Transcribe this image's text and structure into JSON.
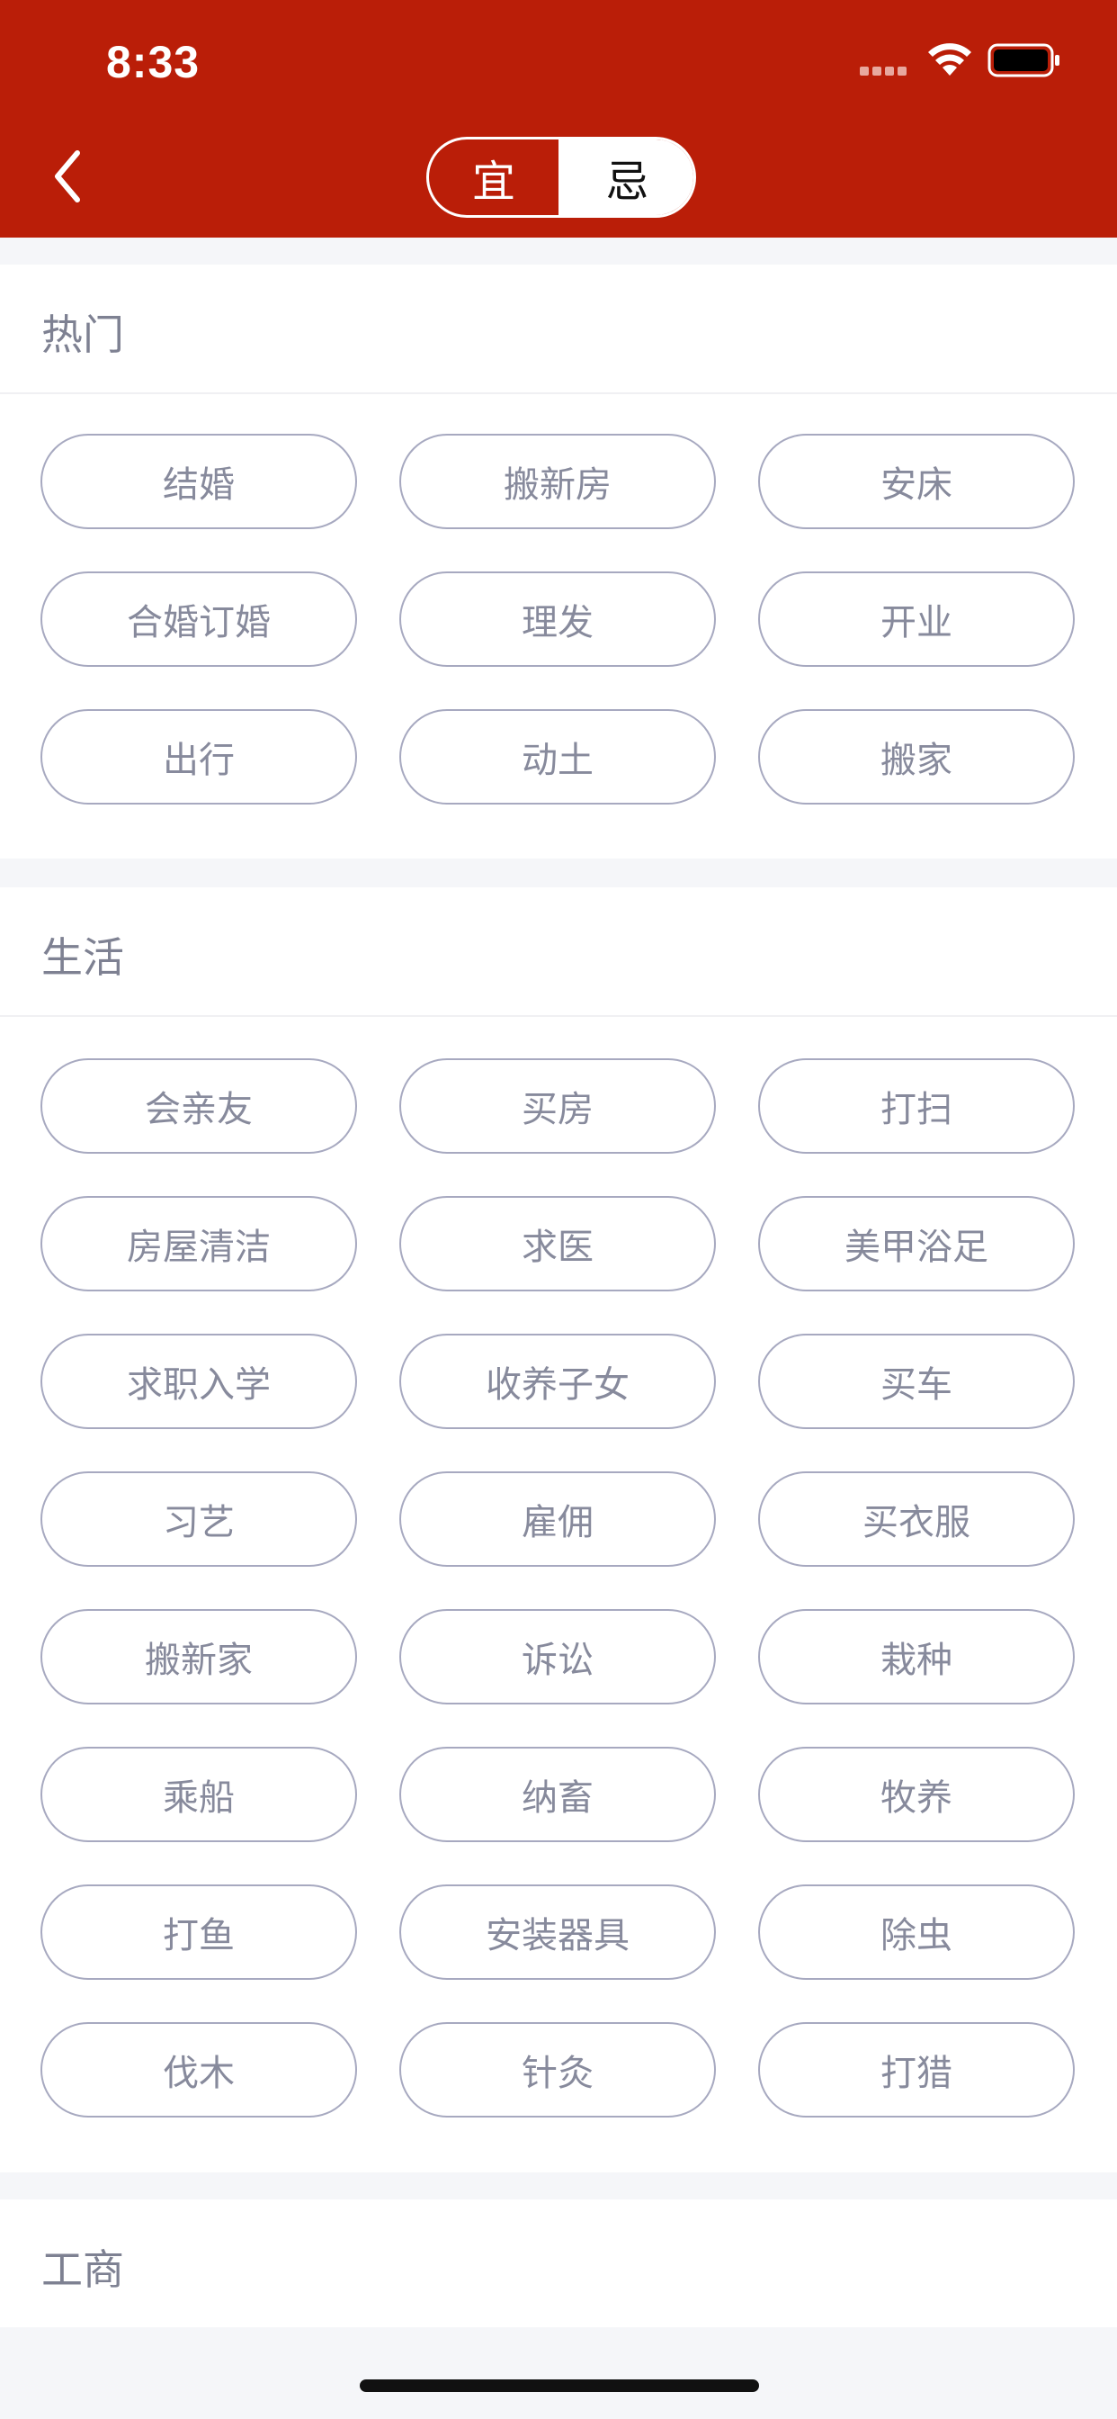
{
  "status_bar": {
    "time": "8:33"
  },
  "segmented": {
    "left_label": "宜",
    "right_label": "忌",
    "selected": "忌"
  },
  "sections": [
    {
      "title": "热门",
      "items": [
        "结婚",
        "搬新房",
        "安床",
        "合婚订婚",
        "理发",
        "开业",
        "出行",
        "动土",
        "搬家"
      ]
    },
    {
      "title": "生活",
      "items": [
        "会亲友",
        "买房",
        "打扫",
        "房屋清洁",
        "求医",
        "美甲浴足",
        "求职入学",
        "收养子女",
        "买车",
        "习艺",
        "雇佣",
        "买衣服",
        "搬新家",
        "诉讼",
        "栽种",
        "乘船",
        "纳畜",
        "牧养",
        "打鱼",
        "安装器具",
        "除虫",
        "伐木",
        "针灸",
        "打猎"
      ]
    },
    {
      "title": "工商",
      "items": []
    }
  ],
  "colors": {
    "header_bg": "#BA1E08",
    "pill_border": "#A7A9C0",
    "pill_text": "#878A9C",
    "title_text": "#7E8192",
    "page_bg": "#F5F6F9"
  },
  "icons": [
    "back-chevron-icon",
    "signal-icon",
    "wifi-icon",
    "battery-icon"
  ]
}
